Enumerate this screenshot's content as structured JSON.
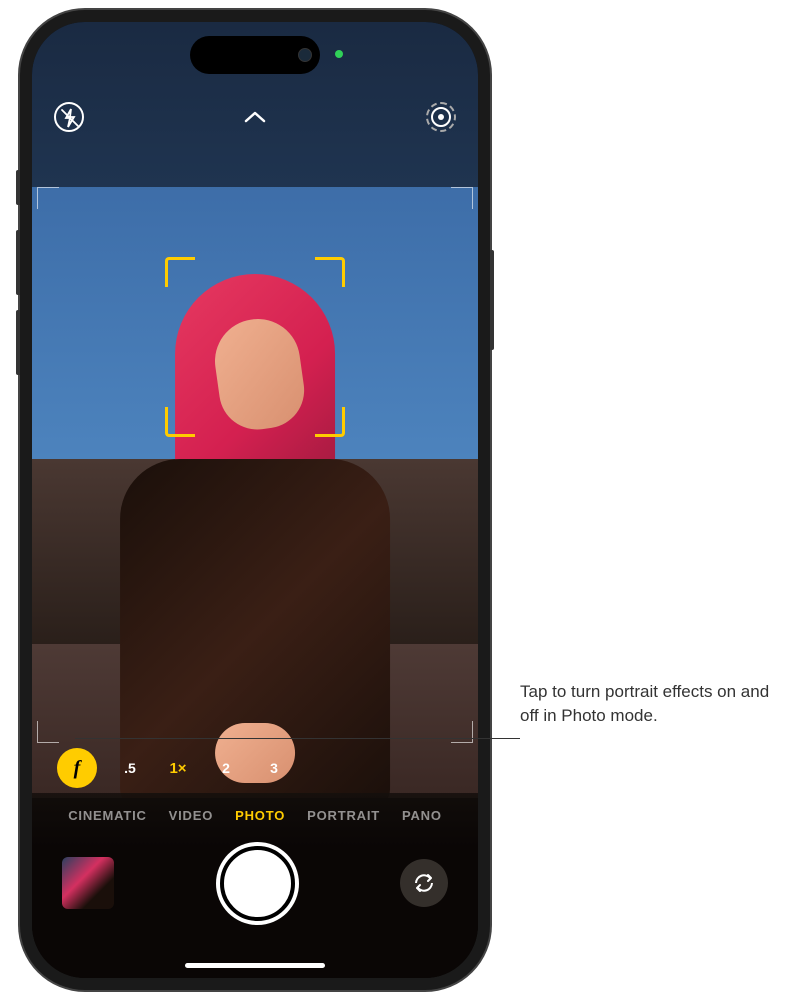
{
  "top_controls": {
    "flash": "flash-off",
    "caret": "chevron-up",
    "live_photo": "live-photo"
  },
  "zoom": {
    "depth_label": "f",
    "levels": [
      {
        "label": ".5",
        "active": false
      },
      {
        "label": "1×",
        "active": true
      },
      {
        "label": "2",
        "active": false
      },
      {
        "label": "3",
        "active": false
      }
    ]
  },
  "modes": [
    {
      "label": "CINEMATIC",
      "active": false
    },
    {
      "label": "VIDEO",
      "active": false
    },
    {
      "label": "PHOTO",
      "active": true
    },
    {
      "label": "PORTRAIT",
      "active": false
    },
    {
      "label": "PANO",
      "active": false
    }
  ],
  "callout": {
    "text": "Tap to turn portrait effects on and off in Photo mode."
  }
}
